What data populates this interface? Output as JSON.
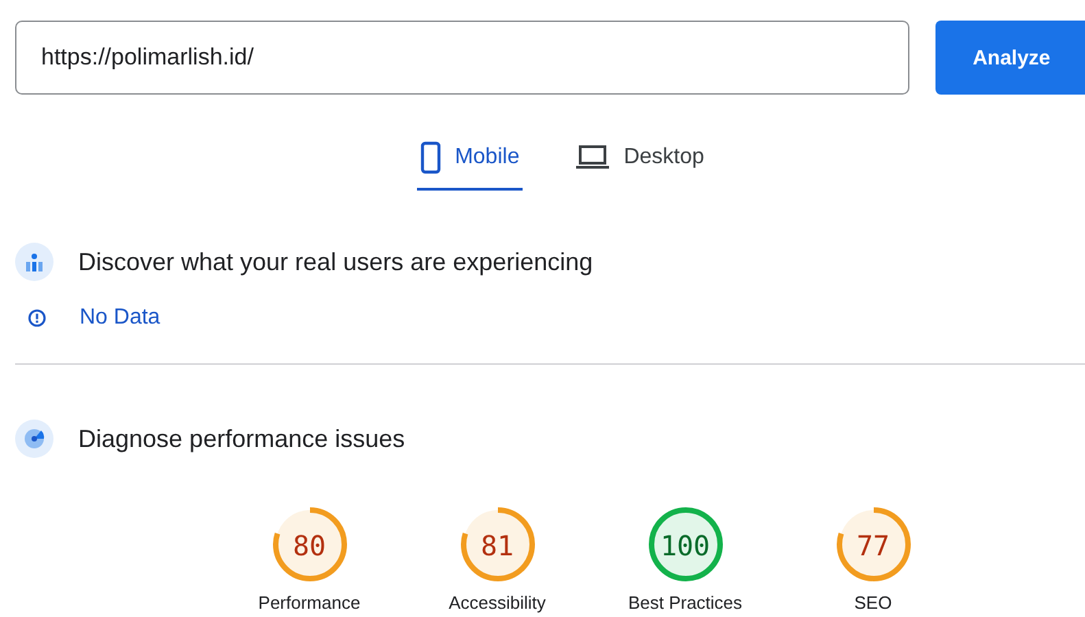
{
  "url_field": {
    "value": "https://polimarlish.id/"
  },
  "analyze_button": "Analyze",
  "tabs": [
    {
      "label": "Mobile",
      "kind": "phone",
      "selected": true
    },
    {
      "label": "Desktop",
      "kind": "laptop",
      "selected": false
    }
  ],
  "field_section": {
    "title": "Discover what your real users are experiencing",
    "status": "No Data"
  },
  "lab_section": {
    "title": "Diagnose performance issues"
  },
  "scores": [
    {
      "value": "80",
      "label": "Performance",
      "color": "#f29c1f"
    },
    {
      "value": "81",
      "label": "Accessibility",
      "color": "#f29c1f"
    },
    {
      "value": "100",
      "label": "Best Practices",
      "color": "#13b24b"
    },
    {
      "value": "77",
      "label": "SEO",
      "color": "#f29c1f"
    }
  ]
}
